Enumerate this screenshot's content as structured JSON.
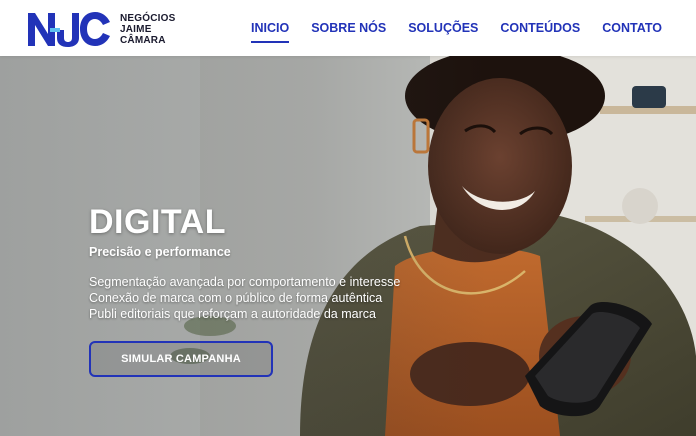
{
  "brand": {
    "logo_mark": "NJC",
    "name_lines": [
      "NEGÓCIOS",
      "JAIME",
      "CÂMARA"
    ],
    "accent_color": "#2233b8"
  },
  "nav": {
    "items": [
      {
        "label": "INICIO",
        "active": true
      },
      {
        "label": "SOBRE NÓS",
        "active": false
      },
      {
        "label": "SOLUÇÕES",
        "active": false
      },
      {
        "label": "CONTEÚDOS",
        "active": false
      },
      {
        "label": "CONTATO",
        "active": false
      }
    ]
  },
  "hero": {
    "title": "DIGITAL",
    "subtitle": "Precisão e performance",
    "bullets": [
      "Segmentação avançada por comportamento e interesse",
      "Conexão de marca com o público de forma autêntica",
      "Publi editoriais que reforçam a autoridade da marca"
    ],
    "cta_label": "SIMULAR CAMPANHA",
    "background_image": "smiling-woman-using-phone"
  }
}
